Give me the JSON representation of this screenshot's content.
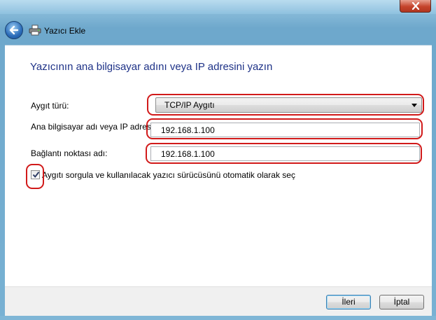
{
  "window": {
    "title": "Yazıcı Ekle"
  },
  "heading": "Yazıcının ana bilgisayar adını veya IP adresini yazın",
  "form": {
    "device_type_label": "Aygıt türü:",
    "device_type_value": "TCP/IP Aygıtı",
    "host_label": "Ana bilgisayar adı veya IP adresi",
    "host_value": "192.168.1.100",
    "port_label": "Bağlantı noktası adı:",
    "port_value": "192.168.1.100",
    "auto_driver_label": "Aygıtı sorgula ve kullanılacak yazıcı sürücüsünü otomatik olarak seç",
    "auto_driver_checked": true
  },
  "buttons": {
    "next": "İleri",
    "cancel": "İptal"
  },
  "icons": {
    "back": "back-arrow-icon",
    "printer": "printer-icon",
    "close": "close-icon",
    "dropdown": "chevron-down-icon",
    "check": "checkmark-icon"
  },
  "colors": {
    "heading": "#1e3287",
    "annotation": "#d11a1a",
    "close_button": "#c5442c"
  }
}
